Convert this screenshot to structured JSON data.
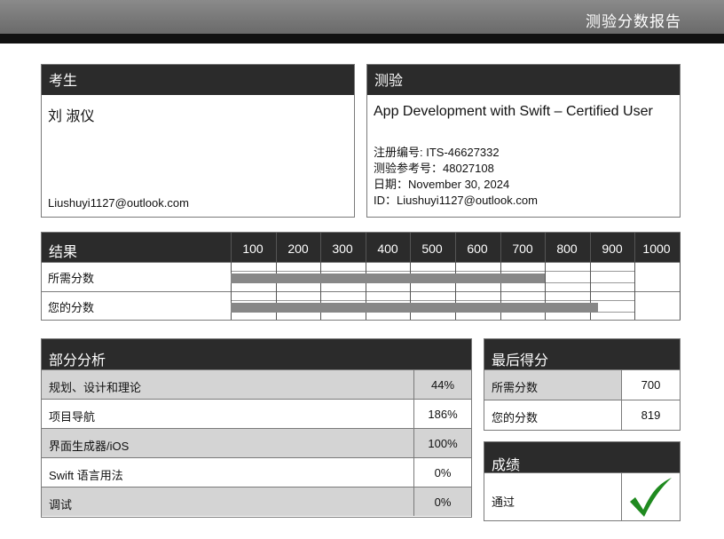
{
  "header": {
    "title": "测验分数报告"
  },
  "candidate": {
    "heading": "考生",
    "name": "刘 淑仪",
    "email": "Liushuyi1127@outlook.com"
  },
  "exam": {
    "heading": "测验",
    "name": "App Development with Swift – Certified User",
    "registration": "注册编号: ITS-46627332",
    "reference": "测验参考号：48027108",
    "date": "日期：November 30, 2024",
    "id": "ID：Liushuyi1127@outlook.com"
  },
  "results": {
    "heading": "结果",
    "required_label": "所需分数",
    "your_label": "您的分数"
  },
  "chart_data": {
    "type": "bar",
    "title": "结果",
    "orientation": "horizontal",
    "x_ticks": [
      100,
      200,
      300,
      400,
      500,
      600,
      700,
      800,
      900,
      1000
    ],
    "categories": [
      "所需分数",
      "您的分数"
    ],
    "values": [
      700,
      819
    ],
    "xlim": [
      0,
      1000
    ],
    "bar_color": "#878787"
  },
  "sections": {
    "heading": "部分分析",
    "rows": [
      {
        "label": "规划、设计和理论",
        "value": "44%"
      },
      {
        "label": "项目导航",
        "value": "186%"
      },
      {
        "label": "界面生成器/iOS",
        "value": "100%"
      },
      {
        "label": "Swift 语言用法",
        "value": "0%"
      },
      {
        "label": "调试",
        "value": "0%"
      }
    ]
  },
  "final": {
    "heading": "最后得分",
    "required_label": "所需分数",
    "required_value": "700",
    "your_label": "您的分数",
    "your_value": "819"
  },
  "grade": {
    "heading": "成绩",
    "result": "通过",
    "icon": "check-icon",
    "check_color": "#1f8a1f"
  },
  "colors": {
    "header_bg": "#2b2b2b",
    "shade": "#d4d4d4",
    "top_bar": "#7a7a7a"
  }
}
